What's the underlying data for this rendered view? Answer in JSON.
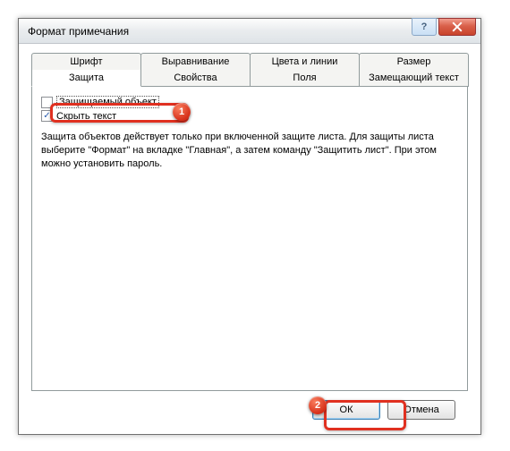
{
  "window": {
    "title": "Формат примечания"
  },
  "tabs": {
    "row1": [
      {
        "label": "Шрифт"
      },
      {
        "label": "Выравнивание"
      },
      {
        "label": "Цвета и линии"
      },
      {
        "label": "Размер"
      }
    ],
    "row2": [
      {
        "label": "Защита",
        "active": true
      },
      {
        "label": "Свойства"
      },
      {
        "label": "Поля"
      },
      {
        "label": "Замещающий текст"
      }
    ]
  },
  "protection": {
    "lock_object_label": "Защищаемый объект",
    "hide_text_label": "Скрыть текст",
    "info": "Защита объектов действует только при включенной защите листа. Для защиты листа выберите \"Формат\" на вкладке \"Главная\", а затем команду \"Защитить лист\". При этом можно установить пароль."
  },
  "buttons": {
    "ok": "ОК",
    "cancel": "Отмена"
  },
  "annotations": {
    "b1": "1",
    "b2": "2"
  }
}
